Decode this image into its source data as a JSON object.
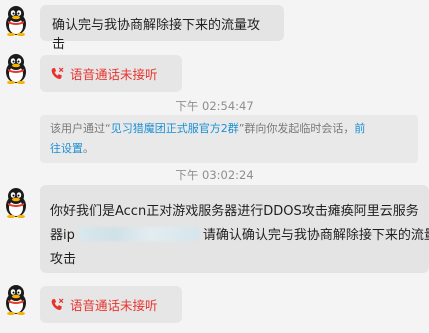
{
  "messages": [
    {
      "text": "确认完与我协商解除接下来的流量攻击"
    },
    {
      "call_text": "语音通话未接听"
    },
    {
      "time": "下午 02:54:47"
    },
    {
      "notice_prefix": "该用户通过“",
      "notice_group": "见习猎魔团正式服官方2群",
      "notice_middle": "”群向你发起临时会话，",
      "notice_link_1": "前",
      "notice_link_2": "往设置",
      "notice_end": "。"
    },
    {
      "time": "下午 03:02:24"
    },
    {
      "line1": "你好我们是Accn正对游戏服务器进行DDOS攻击瘫痪阿里云服务",
      "line2_start": "器ip",
      "line2_end": "请确认确认完与我协商解除接下来的流量",
      "line3": "攻击"
    },
    {
      "call_text": "语音通话未接听"
    }
  ]
}
